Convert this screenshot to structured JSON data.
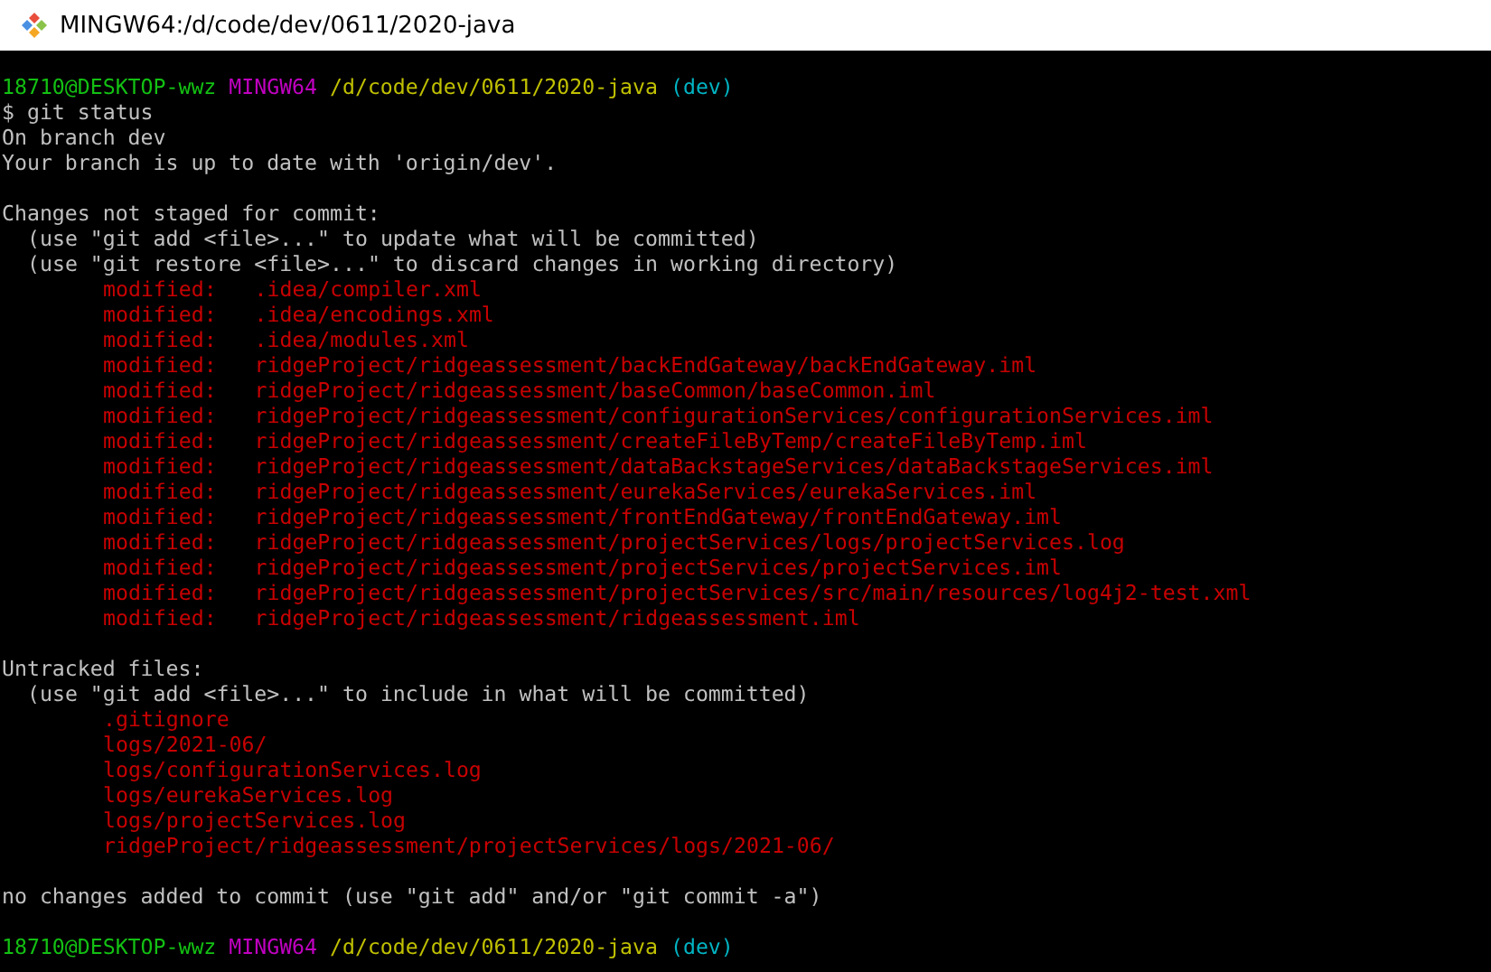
{
  "window": {
    "title": "MINGW64:/d/code/dev/0611/2020-java"
  },
  "terminal": {
    "lines": [
      {
        "kind": "prompt",
        "user": "18710@DESKTOP-wwz",
        "system": "MINGW64",
        "path": "/d/code/dev/0611/2020-java",
        "branch": "(dev)"
      },
      {
        "kind": "command",
        "text": "$ git status"
      },
      {
        "kind": "plain",
        "text": "On branch dev"
      },
      {
        "kind": "plain",
        "text": "Your branch is up to date with 'origin/dev'."
      },
      {
        "kind": "blank"
      },
      {
        "kind": "plain",
        "text": "Changes not staged for commit:"
      },
      {
        "kind": "hint",
        "text": "(use \"git add <file>...\" to update what will be committed)"
      },
      {
        "kind": "hint",
        "text": "(use \"git restore <file>...\" to discard changes in working directory)"
      },
      {
        "kind": "modified",
        "status": "modified:",
        "path": ".idea/compiler.xml"
      },
      {
        "kind": "modified",
        "status": "modified:",
        "path": ".idea/encodings.xml"
      },
      {
        "kind": "modified",
        "status": "modified:",
        "path": ".idea/modules.xml"
      },
      {
        "kind": "modified",
        "status": "modified:",
        "path": "ridgeProject/ridgeassessment/backEndGateway/backEndGateway.iml"
      },
      {
        "kind": "modified",
        "status": "modified:",
        "path": "ridgeProject/ridgeassessment/baseCommon/baseCommon.iml"
      },
      {
        "kind": "modified",
        "status": "modified:",
        "path": "ridgeProject/ridgeassessment/configurationServices/configurationServices.iml"
      },
      {
        "kind": "modified",
        "status": "modified:",
        "path": "ridgeProject/ridgeassessment/createFileByTemp/createFileByTemp.iml"
      },
      {
        "kind": "modified",
        "status": "modified:",
        "path": "ridgeProject/ridgeassessment/dataBackstageServices/dataBackstageServices.iml"
      },
      {
        "kind": "modified",
        "status": "modified:",
        "path": "ridgeProject/ridgeassessment/eurekaServices/eurekaServices.iml"
      },
      {
        "kind": "modified",
        "status": "modified:",
        "path": "ridgeProject/ridgeassessment/frontEndGateway/frontEndGateway.iml"
      },
      {
        "kind": "modified",
        "status": "modified:",
        "path": "ridgeProject/ridgeassessment/projectServices/logs/projectServices.log"
      },
      {
        "kind": "modified",
        "status": "modified:",
        "path": "ridgeProject/ridgeassessment/projectServices/projectServices.iml"
      },
      {
        "kind": "modified",
        "status": "modified:",
        "path": "ridgeProject/ridgeassessment/projectServices/src/main/resources/log4j2-test.xml"
      },
      {
        "kind": "modified",
        "status": "modified:",
        "path": "ridgeProject/ridgeassessment/ridgeassessment.iml"
      },
      {
        "kind": "blank"
      },
      {
        "kind": "plain",
        "text": "Untracked files:"
      },
      {
        "kind": "hint",
        "text": "(use \"git add <file>...\" to include in what will be committed)"
      },
      {
        "kind": "untracked",
        "path": ".gitignore"
      },
      {
        "kind": "untracked",
        "path": "logs/2021-06/"
      },
      {
        "kind": "untracked",
        "path": "logs/configurationServices.log"
      },
      {
        "kind": "untracked",
        "path": "logs/eurekaServices.log"
      },
      {
        "kind": "untracked",
        "path": "logs/projectServices.log"
      },
      {
        "kind": "untracked",
        "path": "ridgeProject/ridgeassessment/projectServices/logs/2021-06/"
      },
      {
        "kind": "blank"
      },
      {
        "kind": "plain",
        "text": "no changes added to commit (use \"git add\" and/or \"git commit -a\")"
      },
      {
        "kind": "blank"
      },
      {
        "kind": "prompt",
        "user": "18710@DESKTOP-wwz",
        "system": "MINGW64",
        "path": "/d/code/dev/0611/2020-java",
        "branch": "(dev)"
      }
    ]
  }
}
